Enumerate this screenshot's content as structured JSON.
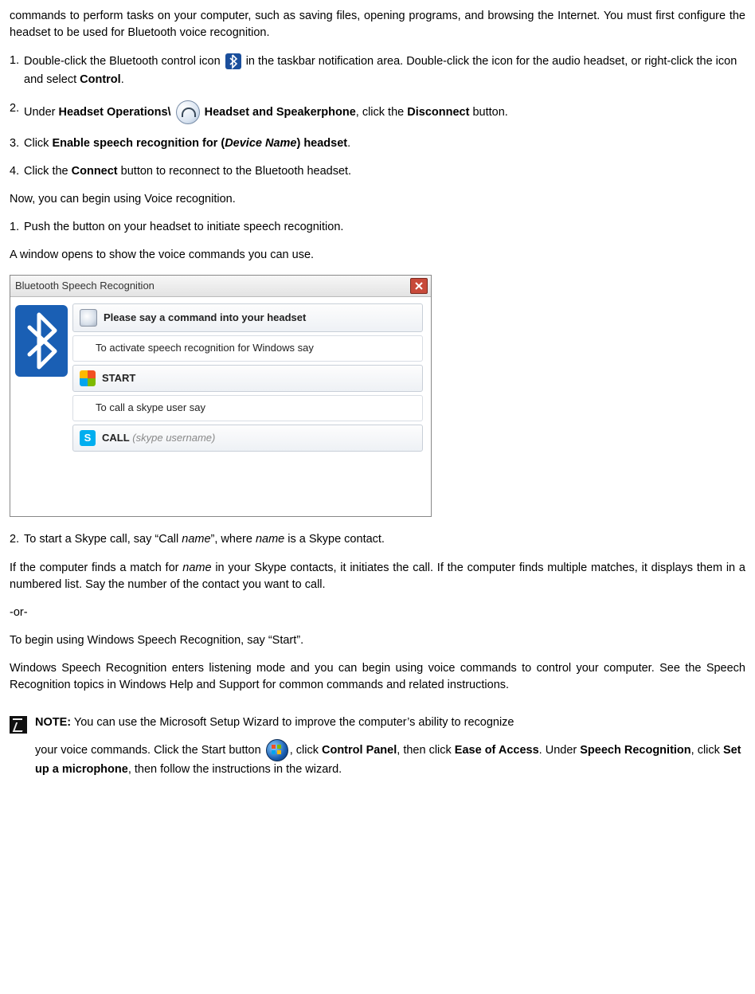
{
  "intro": "commands to perform tasks on your computer, such as saving files, opening programs, and browsing the Internet. You must first configure the headset to be used for Bluetooth voice recognition.",
  "step1": {
    "num": "1.",
    "pre": "Double-click the Bluetooth control icon ",
    "post": "in the taskbar notification area. Double-click the icon for the audio headset, or right-click the icon and select ",
    "bold_end": "Control",
    "tail": "."
  },
  "step2": {
    "num": "2.",
    "pre": "Under ",
    "b1": "Headset Operations\\",
    "mid": " ",
    "b2": "Headset and Speakerphone",
    "post": ", click the ",
    "b3": "Disconnect",
    "tail": " button."
  },
  "step3": {
    "num": "3.",
    "pre": "Click ",
    "b1": "Enable speech recognition for (",
    "bi": "Device Name",
    "b2": ") headset",
    "tail": "."
  },
  "step4": {
    "num": "4.",
    "pre": "Click the ",
    "b1": "Connect",
    "tail": " button to reconnect to the Bluetooth headset."
  },
  "nowline": "Now, you can begin using Voice recognition.",
  "push1": {
    "num": "1.",
    "text": "Push the button on your headset to initiate speech recognition."
  },
  "windowopens": "A window opens to show the voice commands you can use.",
  "screenshot": {
    "title": "Bluetooth Speech Recognition",
    "row1": "Please say a command into your headset",
    "row2": "To activate speech recognition for Windows say",
    "row3": "START",
    "row4": "To call a skype user say",
    "row5a": "CALL",
    "row5b": "(skype username)"
  },
  "s2": {
    "num": "2.",
    "pre": "To start a Skype call, say “Call ",
    "i1": "name",
    "mid": "”, where ",
    "i2": "name",
    "tail": " is a Skype contact."
  },
  "match": {
    "pre": "If the computer finds a match for ",
    "i1": "name",
    "tail": " in your Skype contacts, it initiates the call. If the computer finds multiple matches, it displays them in a numbered list. Say the number of the contact you want to call."
  },
  "or": "-or-",
  "startline": "To begin using Windows Speech Recognition, say “Start”.",
  "listening": "Windows Speech Recognition enters listening mode and you can begin using voice commands to control your computer. See the Speech Recognition topics in Windows Help and Support for common commands and related instructions.",
  "note": {
    "label": "NOTE:",
    "l1": " You can use the Microsoft Setup Wizard to improve the computer’s ability to recognize",
    "l2a": "your voice commands. Click the Start button ",
    "l2b": ", click ",
    "b1": "Control Panel",
    "l2c": ", then click ",
    "b2": "Ease of Access",
    "l3a": ". Under ",
    "b3": "Speech Recognition",
    "l3b": ", click ",
    "b4": "Set up a microphone",
    "l3c": ", then follow the instructions in the wizard."
  }
}
